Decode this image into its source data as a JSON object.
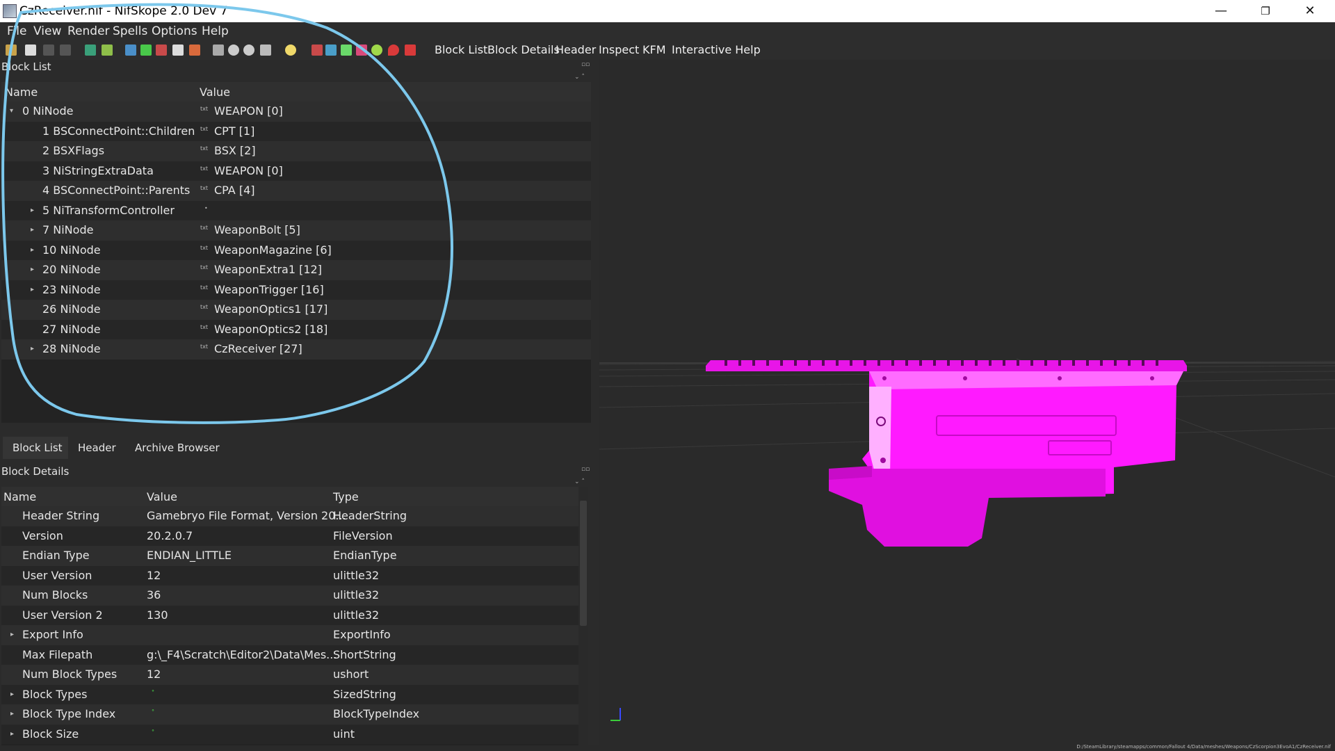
{
  "window": {
    "title": "CzReceiver.nif - NifSkope 2.0 Dev 7",
    "minimize": "—",
    "maximize": "❐",
    "close": "✕"
  },
  "menu": [
    "File",
    "View",
    "Render",
    "Spells",
    "Options",
    "Help"
  ],
  "toolbar_links": [
    "Block List",
    "Block Details",
    "Header",
    "Inspect",
    "KFM",
    "Interactive Help"
  ],
  "block_list": {
    "title": "Block List",
    "columns": [
      "Name",
      "Value"
    ],
    "rows": [
      {
        "name": "0 NiNode",
        "value": "WEAPON [0]"
      },
      {
        "name": "1 BSConnectPoint::Children",
        "value": "CPT [1]"
      },
      {
        "name": "2 BSXFlags",
        "value": "BSX [2]"
      },
      {
        "name": "3 NiStringExtraData",
        "value": "WEAPON [0]"
      },
      {
        "name": "4 BSConnectPoint::Parents",
        "value": "CPA [4]"
      },
      {
        "name": "5 NiTransformController",
        "value": ""
      },
      {
        "name": "7 NiNode",
        "value": "WeaponBolt [5]"
      },
      {
        "name": "10 NiNode",
        "value": "WeaponMagazine [6]"
      },
      {
        "name": "20 NiNode",
        "value": "WeaponExtra1 [12]"
      },
      {
        "name": "23 NiNode",
        "value": "WeaponTrigger [16]"
      },
      {
        "name": "26 NiNode",
        "value": "WeaponOptics1 [17]"
      },
      {
        "name": "27 NiNode",
        "value": "WeaponOptics2 [18]"
      },
      {
        "name": "28 NiNode",
        "value": "CzReceiver [27]"
      }
    ]
  },
  "tabs": [
    "Block List",
    "Header",
    "Archive Browser"
  ],
  "block_details": {
    "title": "Block Details",
    "columns": [
      "Name",
      "Value",
      "Type"
    ],
    "rows": [
      {
        "name": "Header String",
        "value": "Gamebryo File Format, Version 20...",
        "type": "HeaderString"
      },
      {
        "name": "Version",
        "value": "20.2.0.7",
        "type": "FileVersion"
      },
      {
        "name": "Endian Type",
        "value": "ENDIAN_LITTLE",
        "type": "EndianType"
      },
      {
        "name": "User Version",
        "value": "12",
        "type": "ulittle32"
      },
      {
        "name": "Num Blocks",
        "value": "36",
        "type": "ulittle32"
      },
      {
        "name": "User Version 2",
        "value": "130",
        "type": "ulittle32"
      },
      {
        "name": "Export Info",
        "value": "",
        "type": "ExportInfo"
      },
      {
        "name": "Max Filepath",
        "value": "g:\\_F4\\Scratch\\Editor2\\Data\\Mes...",
        "type": "ShortString"
      },
      {
        "name": "Num Block Types",
        "value": "12",
        "type": "ushort"
      },
      {
        "name": "Block Types",
        "value": "",
        "type": "SizedString"
      },
      {
        "name": "Block Type Index",
        "value": "",
        "type": "BlockTypeIndex"
      },
      {
        "name": "Block Size",
        "value": "",
        "type": "uint"
      }
    ]
  },
  "file_path": "D:/SteamLibrary/steamapps/common/Fallout 4/Data/meshes/Weapons/CzScorpion3EvoA1/CzReceiver.nif",
  "colors": {
    "mesh": "#ff1aff",
    "annotation": "#7cc8ec",
    "background": "#2b2b2b"
  }
}
